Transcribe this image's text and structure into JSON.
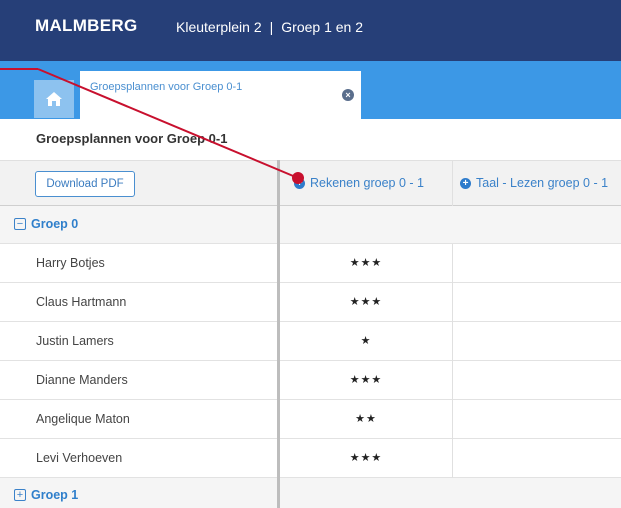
{
  "header": {
    "logo": "MALMBERG",
    "school": "Kleuterplein 2",
    "separator": "|",
    "group": "Groep 1 en 2"
  },
  "tabs": [
    {
      "label": "Groepsplannen voor Groep 0-1",
      "close_icon": "close-circle-icon"
    }
  ],
  "home_icon": "home-icon",
  "page_title": "Groepsplannen voor Groep 0-1",
  "toolbar": {
    "download_label": "Download PDF"
  },
  "columns": [
    {
      "label": "Rekenen groep 0 - 1",
      "icon": "plus-circle-icon"
    },
    {
      "label": "Taal - Lezen groep 0 - 1",
      "icon": "plus-circle-icon"
    }
  ],
  "groups": [
    {
      "label": "Groep 0",
      "toggle": "−",
      "expanded": true,
      "students": [
        {
          "name": "Harry Botjes",
          "stars": "★★★"
        },
        {
          "name": "Claus Hartmann",
          "stars": "★★★"
        },
        {
          "name": "Justin Lamers",
          "stars": "★"
        },
        {
          "name": "Dianne Manders",
          "stars": "★★★"
        },
        {
          "name": "Angelique Maton",
          "stars": "★★"
        },
        {
          "name": "Levi Verhoeven",
          "stars": "★★★"
        }
      ]
    },
    {
      "label": "Groep 1",
      "toggle": "+",
      "expanded": false,
      "students": []
    }
  ],
  "annotation": {
    "color": "#c8102e"
  },
  "colors": {
    "topbar": "#263f78",
    "tabbar": "#3c98e6",
    "accent": "#3b82c9"
  }
}
